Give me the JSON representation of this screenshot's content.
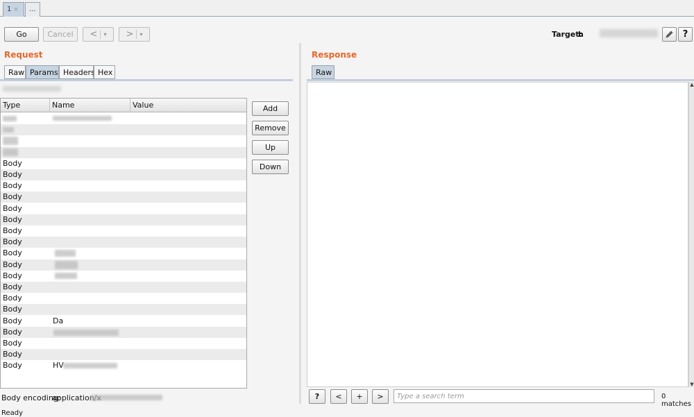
{
  "tabs": [
    {
      "label": "1",
      "close": "×"
    },
    {
      "label": "..."
    }
  ],
  "toolbar": {
    "go": "Go",
    "cancel": "Cancel",
    "back": "<",
    "forward": ">",
    "dropdown": "▾",
    "target_label": "Target:",
    "target_value": "h",
    "edit_icon": "pencil-icon",
    "help": "?"
  },
  "request": {
    "title": "Request",
    "tabs": [
      "Raw",
      "Params",
      "Headers",
      "Hex"
    ],
    "active_tab": "Params",
    "columns": [
      "Type",
      "Name",
      "Value"
    ],
    "rows": [
      {
        "type": "",
        "name": ""
      },
      {
        "type": "",
        "name": ""
      },
      {
        "type": "",
        "name": ""
      },
      {
        "type": "",
        "name": ""
      },
      {
        "type": "Body",
        "name": ""
      },
      {
        "type": "Body",
        "name": ""
      },
      {
        "type": "Body",
        "name": ""
      },
      {
        "type": "Body",
        "name": ""
      },
      {
        "type": "Body",
        "name": ""
      },
      {
        "type": "Body",
        "name": ""
      },
      {
        "type": "Body",
        "name": ""
      },
      {
        "type": "Body",
        "name": ""
      },
      {
        "type": "Body",
        "name": ""
      },
      {
        "type": "Body",
        "name": ""
      },
      {
        "type": "Body",
        "name": ""
      },
      {
        "type": "Body",
        "name": ""
      },
      {
        "type": "Body",
        "name": ""
      },
      {
        "type": "Body",
        "name": ""
      },
      {
        "type": "Body",
        "name": "Da"
      },
      {
        "type": "Body",
        "name": ""
      },
      {
        "type": "Body",
        "name": ""
      },
      {
        "type": "Body",
        "name": ""
      },
      {
        "type": "Body",
        "name": "HV"
      }
    ],
    "buttons": {
      "add": "Add",
      "remove": "Remove",
      "up": "Up",
      "down": "Down"
    },
    "encoding_label": "Body encoding:",
    "encoding_value": "application/x"
  },
  "response": {
    "title": "Response",
    "tabs": [
      "Raw"
    ],
    "help": "?",
    "prev": "<",
    "add": "+",
    "next": ">",
    "search_placeholder": "Type a search term",
    "matches": "0 matches"
  },
  "status": "Ready",
  "colors": {
    "accent": "#e8672a",
    "active_tab": "#c7d4e2"
  }
}
